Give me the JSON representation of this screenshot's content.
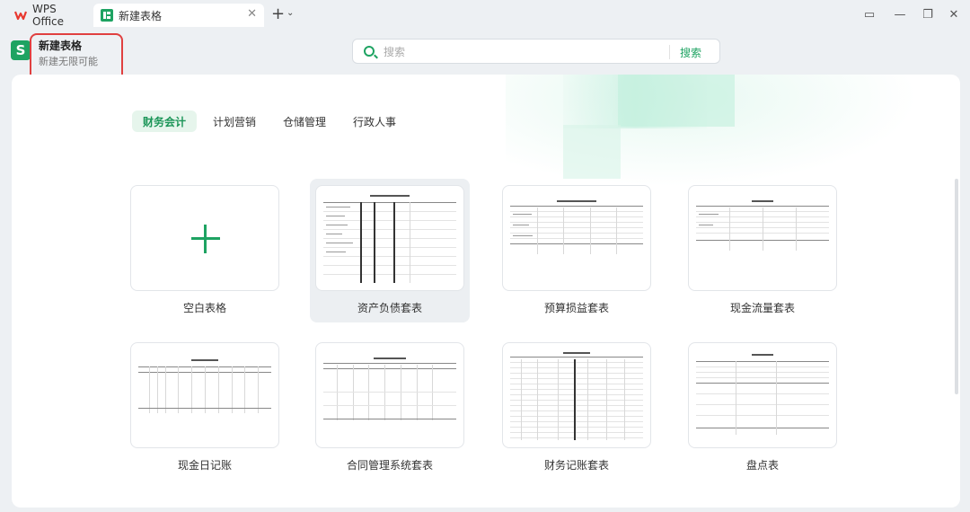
{
  "titlebar": {
    "tabs": [
      {
        "label": "WPS Office",
        "icon": "wps-logo-icon"
      },
      {
        "label": "新建表格",
        "icon": "spreadsheet-icon",
        "active": true
      }
    ],
    "close_glyph": "✕",
    "add_glyph": "+",
    "add_menu_glyph": "⌄",
    "window_controls": {
      "tile": "▭",
      "minimize": "—",
      "restore": "❐",
      "close": "✕"
    }
  },
  "header": {
    "app_badge": "S",
    "title": "新建表格",
    "subtitle": "新建无限可能"
  },
  "search": {
    "placeholder": "搜索",
    "button_label": "搜索"
  },
  "categories": [
    {
      "label": "财务会计",
      "active": true
    },
    {
      "label": "计划营销",
      "active": false
    },
    {
      "label": "仓储管理",
      "active": false
    },
    {
      "label": "行政人事",
      "active": false
    }
  ],
  "templates": [
    {
      "label": "空白表格"
    },
    {
      "label": "资产负债套表"
    },
    {
      "label": "预算损益套表"
    },
    {
      "label": "现金流量套表"
    },
    {
      "label": "现金日记账"
    },
    {
      "label": "合同管理系统套表"
    },
    {
      "label": "财务记账套表"
    },
    {
      "label": "盘点表"
    }
  ],
  "colors": {
    "accent": "#1ea362",
    "highlight_box": "#e04040",
    "active_category_bg": "#e6f5ec"
  }
}
